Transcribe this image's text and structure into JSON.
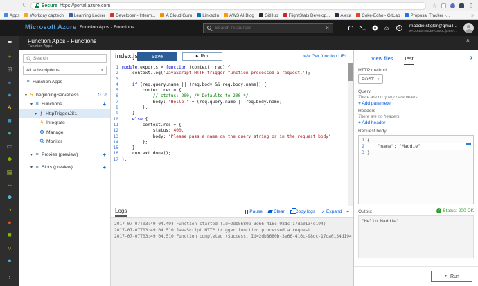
{
  "browser": {
    "url": "https://portal.azure.com",
    "secure_label": "Secure",
    "bookmarks": [
      {
        "label": "Apps",
        "color": "#4285f4"
      },
      {
        "label": "Workday captech",
        "color": "#f6a821"
      },
      {
        "label": "Learning Locker",
        "color": "#3b5fa0"
      },
      {
        "label": "Developer - Interm...",
        "color": "#d93025"
      },
      {
        "label": "A Cloud Guru",
        "color": "#f29100"
      },
      {
        "label": "LinkedIn",
        "color": "#0077b5"
      },
      {
        "label": "AWS AI Blog",
        "color": "#ff9900"
      },
      {
        "label": "GitHub",
        "color": "#24292e"
      },
      {
        "label": "FlightStats Develop...",
        "color": "#cf2030"
      },
      {
        "label": "Alexa",
        "color": "#232f3e"
      },
      {
        "label": "Coke-Echo - GitLab",
        "color": "#e24329"
      },
      {
        "label": "Proposal Tracker -...",
        "color": "#1a73e8"
      }
    ],
    "overflow": "»"
  },
  "topbar": {
    "brand": "Microsoft Azure",
    "breadcrumb": "Function Apps - Functions",
    "search_placeholder": "Search resources",
    "account_email": "maddie.stigler@gmail...",
    "account_tenant": "MADDIESTIGLERGMAIL (DEFA...",
    "shell_glyph": ">_"
  },
  "blade": {
    "title": "Function Apps - Functions",
    "subtitle": "Function Apps",
    "close_glyph": "×"
  },
  "rail_icons": [
    {
      "name": "hamburger-menu",
      "glyph": "≡",
      "color": "#ffffff"
    },
    {
      "name": "new-resource",
      "glyph": "+",
      "color": "#86bc25"
    },
    {
      "name": "dashboard",
      "glyph": "⊞",
      "color": "#86bc25"
    },
    {
      "name": "all-resources",
      "glyph": "●",
      "color": "#4d6b8c"
    },
    {
      "name": "resource-groups",
      "glyph": "●",
      "color": "#3999c6"
    },
    {
      "name": "function-apps",
      "glyph": "ϟ",
      "color": "#fcd116"
    },
    {
      "name": "sql-databases",
      "glyph": "■",
      "color": "#3999c6"
    },
    {
      "name": "cosmos-db",
      "glyph": "●",
      "color": "#45b5a9"
    },
    {
      "name": "virtual-machines",
      "glyph": "▭",
      "color": "#59b4d9"
    },
    {
      "name": "load-balancers",
      "glyph": "◆",
      "color": "#7fba00"
    },
    {
      "name": "storage-accounts",
      "glyph": "▤",
      "color": "#b8d432"
    },
    {
      "name": "virtual-networks",
      "glyph": "↔",
      "color": "#7fba00"
    },
    {
      "name": "azure-active-directory",
      "glyph": "◆",
      "color": "#59b4d9"
    },
    {
      "name": "monitor",
      "glyph": "◔",
      "color": "#fcd116"
    },
    {
      "name": "advisor",
      "glyph": "●",
      "color": "#e25822"
    },
    {
      "name": "security-center",
      "glyph": "■",
      "color": "#7fba00"
    },
    {
      "name": "cost-management",
      "glyph": "○",
      "color": "#fcd116"
    },
    {
      "name": "help-support",
      "glyph": "●",
      "color": "#59b4d9"
    },
    {
      "name": "rail-expand",
      "glyph": "›",
      "color": "#cccccc"
    }
  ],
  "nav": {
    "search_placeholder": "Search",
    "subscriptions": "All subscriptions",
    "function_apps": "Function Apps",
    "app": "beginningServerless",
    "functions": "Functions",
    "trigger": "HttpTriggerJS1",
    "integrate": "Integrate",
    "manage": "Manage",
    "monitor": "Monitor",
    "proxies": "Proxies (preview)",
    "slots": "Slots (preview)"
  },
  "editor": {
    "filename": "index.js",
    "save_label": "Save",
    "run_label": "Run",
    "get_url_label": "</> Get function URL",
    "code_lines": [
      [
        [
          "k",
          "module"
        ],
        [
          "p",
          ".exports = "
        ],
        [
          "k",
          "function"
        ],
        [
          "p",
          " (context, req) {"
        ]
      ],
      [
        [
          "p",
          "    context.log("
        ],
        [
          "s",
          "'JavaScript HTTP trigger function processed a request.'"
        ],
        [
          "p",
          ");"
        ]
      ],
      [],
      [
        [
          "p",
          "    "
        ],
        [
          "k",
          "if"
        ],
        [
          "p",
          " (req.query.name || (req.body && req.body.name)) {"
        ]
      ],
      [
        [
          "p",
          "        context.res = {"
        ]
      ],
      [
        [
          "c",
          "            // status: 200, /* Defaults to 200 */"
        ]
      ],
      [
        [
          "p",
          "            body: "
        ],
        [
          "s",
          "\"Hello \""
        ],
        [
          "p",
          " + (req.query.name || req.body.name)"
        ]
      ],
      [
        [
          "p",
          "        };"
        ]
      ],
      [
        [
          "p",
          "    }"
        ]
      ],
      [
        [
          "p",
          "    "
        ],
        [
          "k",
          "else"
        ],
        [
          "p",
          " {"
        ]
      ],
      [
        [
          "p",
          "        context.res = {"
        ]
      ],
      [
        [
          "p",
          "            status: "
        ],
        [
          "n",
          "400"
        ],
        [
          "p",
          ","
        ]
      ],
      [
        [
          "p",
          "            body: "
        ],
        [
          "s",
          "\"Please pass a name on the query string or in the request body\""
        ]
      ],
      [
        [
          "p",
          "        };"
        ]
      ],
      [
        [
          "p",
          "    }"
        ]
      ],
      [
        [
          "p",
          "    context.done();"
        ]
      ],
      [
        [
          "p",
          "};"
        ]
      ]
    ]
  },
  "logs": {
    "title": "Logs",
    "pause_label": "Pause",
    "clear_label": "Clear",
    "copy_label": "Copy logs",
    "expand_label": "Expand",
    "expand_glyph": "↗",
    "lines": [
      "2017-07-07T03:49:04.494 Function started (Id=2db8680b-3e66-416c-98dc-17da0134d194)",
      "2017-07-07T03:49:04.510 JavaScript HTTP trigger function processed a request.",
      "2017-07-07T03:49:04.510 Function completed (Success, Id=2db8680b-3e66-416c-98dc-17da0134d194, Du"
    ]
  },
  "test": {
    "view_files_tab": "View files",
    "test_tab": "Test",
    "http_method_label": "HTTP method",
    "http_method": "POST",
    "query_label": "Query",
    "query_empty": "There are no query parameters",
    "add_parameter": "Add parameter",
    "headers_label": "Headers",
    "headers_empty": "There are no headers",
    "add_header": "Add header",
    "request_body_label": "Request body",
    "request_body_lines": [
      "{",
      "    \"name\": \"Maddie\"",
      "}"
    ],
    "output_label": "Output",
    "status_text": "Status: 200 OK",
    "output_value": "\"Hello Maddie\"",
    "run_label": "Run"
  },
  "glyphs": {
    "back": "←",
    "forward": "→",
    "refresh": "↻",
    "star": "☆",
    "dots": "⋮",
    "smiley": "☺",
    "help": "?",
    "search_clear": "×",
    "caret_down": "▾",
    "chevron_right": "›",
    "chevron_double": "»",
    "plus": "+",
    "updown": "↕",
    "play": "►",
    "check": "✓",
    "fx": "ƒ",
    "lightning": "ϟ",
    "list": "≡"
  },
  "colors": {
    "accent_blue": "#0072c6",
    "link_blue": "#015cda",
    "status_green": "#2e9b2e",
    "selected_row": "#dceaf7",
    "topbar_bg": "#1a1a1a",
    "rail_bg": "#2e2e2e"
  }
}
